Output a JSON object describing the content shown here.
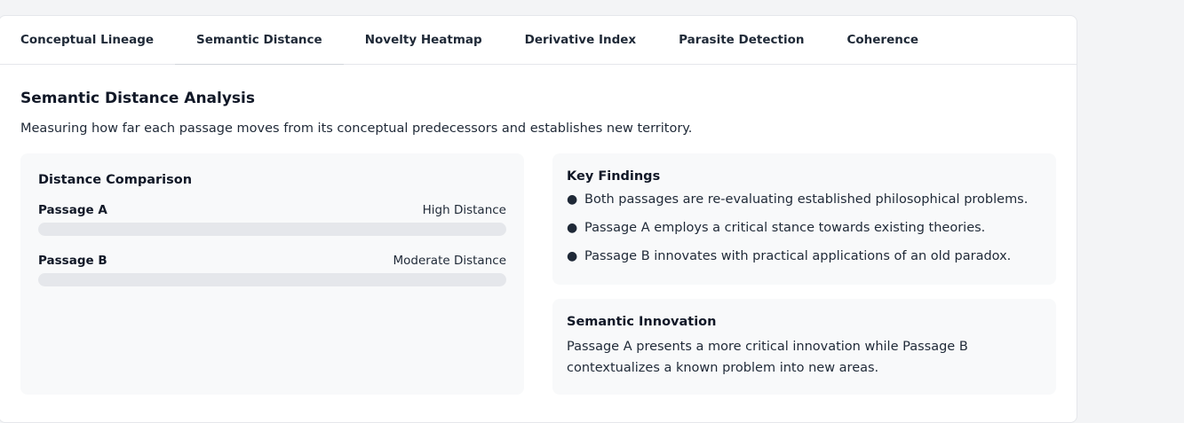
{
  "tabs": [
    {
      "label": "Conceptual Lineage"
    },
    {
      "label": "Semantic Distance"
    },
    {
      "label": "Novelty Heatmap"
    },
    {
      "label": "Derivative Index"
    },
    {
      "label": "Parasite Detection"
    },
    {
      "label": "Coherence"
    }
  ],
  "active_tab": "Semantic Distance",
  "main": {
    "title": "Semantic Distance Analysis",
    "subtitle": "Measuring how far each passage moves from its conceptual predecessors and establishes new territory."
  },
  "distance": {
    "title": "Distance Comparison",
    "rows": [
      {
        "label": "Passage A",
        "value": "High Distance",
        "fill": 0
      },
      {
        "label": "Passage B",
        "value": "Moderate Distance",
        "fill": 0
      }
    ]
  },
  "findings": {
    "title": "Key Findings",
    "items": [
      "Both passages are re-evaluating established philosophical problems.",
      "Passage A employs a critical stance towards existing theories.",
      "Passage B innovates with practical applications of an old paradox."
    ]
  },
  "innovation": {
    "title": "Semantic Innovation",
    "text": "Passage A presents a more critical innovation while Passage B contextualizes a known problem into new areas."
  },
  "colors": {
    "background": "#f3f4f6",
    "card": "#ffffff",
    "panel": "#f8f9fa",
    "bar_track": "#e5e7eb",
    "text": "#111827"
  }
}
